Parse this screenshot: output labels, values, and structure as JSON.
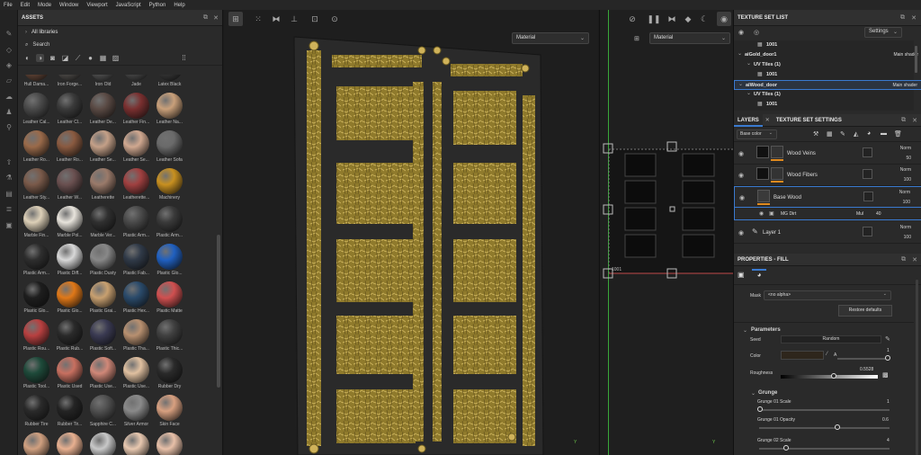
{
  "menu": [
    "File",
    "Edit",
    "Mode",
    "Window",
    "Viewport",
    "JavaScript",
    "Python",
    "Help"
  ],
  "assets": {
    "title": "ASSETS",
    "breadcrumb": "All libraries",
    "search_placeholder": "Search",
    "rows": [
      [
        "Hull Dama...",
        "Iron Forge...",
        "Iron Old",
        "Jade",
        "Latex Black"
      ],
      [
        "Leather Cal...",
        "Leather Cl...",
        "Leather De...",
        "Leather Fin...",
        "Leather Na..."
      ],
      [
        "Leather Ro...",
        "Leather Ro...",
        "Leather Se...",
        "Leather Se...",
        "Leather Sofa"
      ],
      [
        "Leather Sty...",
        "Leather W...",
        "Leatherette",
        "Leatherette...",
        "Machinery"
      ],
      [
        "Marble Fin...",
        "Marble Pol...",
        "Marble Ver...",
        "Plastic Arm...",
        "Plastic Arm..."
      ],
      [
        "Plastic Arm...",
        "Plastic Diff...",
        "Plastic Dusty",
        "Plastic Fab...",
        "Plastic Glo..."
      ],
      [
        "Plastic Glo...",
        "Plastic Glo...",
        "Plastic Grai...",
        "Plastic Hex...",
        "Plastic Matte"
      ],
      [
        "Plastic Rou...",
        "Plastic Rub...",
        "Plastic Soft...",
        "Plastic Tha...",
        "Plastic Thic..."
      ],
      [
        "Plastic Tool...",
        "Plastic Used",
        "Plastic Use...",
        "Plastic Use...",
        "Rubber Dry"
      ],
      [
        "Rubber Tire",
        "Rubber Tir...",
        "Sapphire C...",
        "Silver Armor",
        "Skin Face"
      ]
    ],
    "colors": [
      [
        "#6a4a3a",
        "#55524f",
        "#5a5a5a",
        "#4f4f4f",
        "#3b3b3b"
      ],
      [
        "#4a4a4a",
        "#3a3a3a",
        "#5a4a44",
        "#7a3030",
        "#c9a07a"
      ],
      [
        "#9a6a4a",
        "#8a5a40",
        "#c4a088",
        "#d0a890",
        "#6a6a6a"
      ],
      [
        "#7a5a4a",
        "#6a5050",
        "#9a7a6a",
        "#a04040",
        "#c89020"
      ],
      [
        "#ddd0b8",
        "#e8e4dc",
        "#303030",
        "#4a4a4a",
        "#3a3a3a"
      ],
      [
        "#2e2e2e",
        "#d8d8d8",
        "#888888",
        "#303a48",
        "#2060c0"
      ],
      [
        "#1e1e1e",
        "#e07818",
        "#c8a070",
        "#2a4a6a",
        "#d05050"
      ],
      [
        "#b84040",
        "#2a2a2a",
        "#3a3a52",
        "#b89070",
        "#404040"
      ],
      [
        "#1e4a3a",
        "#c87060",
        "#d08878",
        "#e0c0a0",
        "#2a2a2a"
      ],
      [
        "#2a2a2a",
        "#242424",
        "#505050",
        "#8a8a8a",
        "#d8a080"
      ],
      [
        "#d0a080",
        "#e8b090",
        "#c8c8c8",
        "#e8c8b0",
        "#e8c0a8"
      ]
    ]
  },
  "viewport": {
    "material_left": "Material",
    "material_right": "Material",
    "uv_label": "1001"
  },
  "texture_set_list": {
    "title": "TEXTURE SET LIST",
    "settings": "Settings",
    "items": [
      {
        "name": "1001",
        "indent": 2
      },
      {
        "name": "aiGold_door1",
        "shader": "Main shader",
        "indent": 0
      },
      {
        "name": "UV Tiles (1)",
        "indent": 1
      },
      {
        "name": "1001",
        "indent": 2
      },
      {
        "name": "aiWood_door",
        "shader": "Main shader",
        "indent": 0
      },
      {
        "name": "UV Tiles (1)",
        "indent": 1
      },
      {
        "name": "1001",
        "indent": 2
      }
    ]
  },
  "layers": {
    "tab_layers": "LAYERS",
    "tab_settings": "TEXTURE SET SETTINGS",
    "channel": "Base color",
    "items": [
      {
        "name": "Wood Veins",
        "blend": "Norm",
        "opacity": "50"
      },
      {
        "name": "Wood Fibers",
        "blend": "Norm",
        "opacity": "100"
      },
      {
        "name": "Base Wood",
        "blend": "Norm",
        "opacity": "100"
      },
      {
        "name": "MG Dirt",
        "blend": "Mul",
        "opacity": "40"
      },
      {
        "name": "Layer 1",
        "blend": "Norm",
        "opacity": "100"
      }
    ]
  },
  "properties": {
    "title": "PROPERTIES - FILL",
    "mask_label": "Mask",
    "mask_value": "<no alpha>",
    "restore": "Restore defaults",
    "parameters": "Parameters",
    "seed_label": "Seed",
    "seed_value": "Random",
    "color_label": "Color",
    "color_a": "A",
    "color_val": "1",
    "roughness_label": "Roughness",
    "roughness_value": "0.5528",
    "grunge": "Grunge",
    "g1_scale_label": "Grunge 01 Scale",
    "g1_scale_value": "1",
    "g1_opacity_label": "Grunge 01 Opacity",
    "g1_opacity_value": "0.6",
    "g2_scale_label": "Grunge 02 Scale",
    "g2_scale_value": "4"
  }
}
